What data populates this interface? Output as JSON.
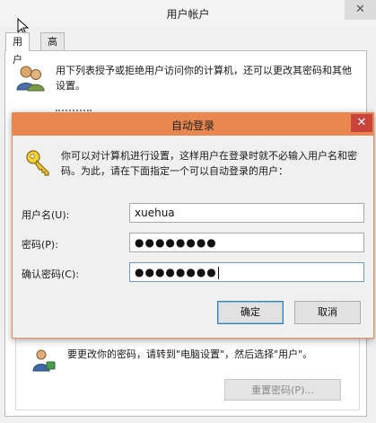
{
  "background_window": {
    "title": "用户帐户",
    "close_glyph": "✕",
    "tabs": [
      {
        "label": "用户",
        "active": true
      },
      {
        "label": "高级",
        "active": false
      }
    ],
    "description": "用下列表授予或拒绝用户访问你的计算机，还可以更改其密码和其他设置。",
    "password_hint": "要更改你的密码，请转到\"电脑设置\"，然后选择\"用户\"。",
    "reset_button": "重置密码(P)..."
  },
  "dialog": {
    "title": "自动登录",
    "close_glyph": "✕",
    "description": "你可以对计算机进行设置，这样用户在登录时就不必输入用户名和密码。为此，请在下面指定一个可以自动登录的用户：",
    "fields": [
      {
        "label": "用户名(U):",
        "value": "xuehua",
        "type": "text"
      },
      {
        "label": "密码(P):",
        "value": "●●●●●●●●",
        "type": "password"
      },
      {
        "label": "确认密码(C):",
        "value": "●●●●●●●●",
        "type": "password",
        "focused": true
      }
    ],
    "ok_label": "确定",
    "cancel_label": "取消"
  },
  "colors": {
    "dialog_title_bar": "#e8874f",
    "close_button": "#c9443a",
    "focus_border": "#6a9bd6"
  },
  "icons": [
    "users-icon",
    "key-icon",
    "user-password-icon",
    "mouse-cursor-icon",
    "close-icon"
  ]
}
